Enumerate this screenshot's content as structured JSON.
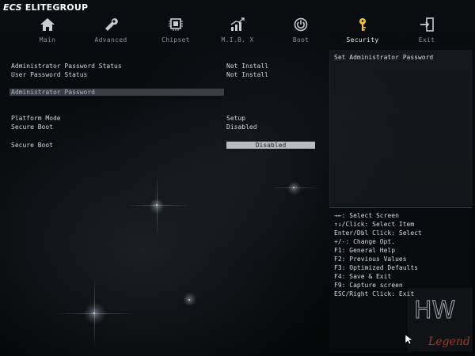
{
  "brand": {
    "mark": "ECS",
    "name": "ELITEGROUP"
  },
  "nav": {
    "active": "security",
    "items": [
      {
        "id": "main",
        "label": "Main",
        "icon": "home-icon"
      },
      {
        "id": "advanced",
        "label": "Advanced",
        "icon": "wrench-icon"
      },
      {
        "id": "chipset",
        "label": "Chipset",
        "icon": "chip-icon"
      },
      {
        "id": "mib",
        "label": "M.I.B. X",
        "icon": "graph-icon"
      },
      {
        "id": "boot",
        "label": "Boot",
        "icon": "power-icon"
      },
      {
        "id": "security",
        "label": "Security",
        "icon": "key-icon"
      },
      {
        "id": "exit",
        "label": "Exit",
        "icon": "exit-door-icon"
      }
    ]
  },
  "settings": {
    "admin_password_status_label": "Administrator Password Status",
    "admin_password_status_value": "Not Install",
    "user_password_status_label": "User Password Status",
    "user_password_status_value": "Not Install",
    "admin_password_item": "Administrator Password",
    "platform_mode_label": "Platform Mode",
    "platform_mode_value": "Setup",
    "secure_boot_status_label": "Secure Boot",
    "secure_boot_status_value": "Disabled",
    "secure_boot_option_label": "Secure Boot",
    "secure_boot_option_value": "Disabled"
  },
  "help": {
    "description": "Set Administrator Password",
    "keys": [
      "→←: Select Screen",
      "↑↓/Click: Select Item",
      "Enter/Dbl Click: Select",
      "+/-: Change Opt.",
      "F1: General Help",
      "F2: Previous Values",
      "F3: Optimized Defaults",
      "F4: Save & Exit",
      "F9: Capture screen",
      "ESC/Right Click: Exit"
    ]
  },
  "watermark": {
    "top": "HW",
    "bottom": "Legend"
  },
  "colors": {
    "background": "#050709",
    "text": "#d3d7db",
    "nav_inactive": "#8c9298",
    "selection_bg": "#3a3f45",
    "option_box": "#b9bdc1"
  }
}
